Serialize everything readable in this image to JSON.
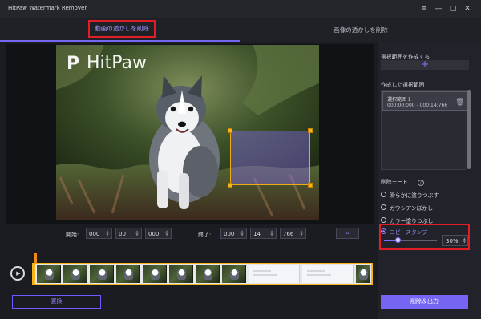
{
  "app": {
    "title": "HitPaw Watermark Remover",
    "window_controls": [
      "≡",
      "—",
      "□",
      "✕"
    ]
  },
  "tabs": {
    "video": "動画の透かしを削除",
    "image": "画像の透かしを削除"
  },
  "preview": {
    "watermark_text": "HitPaw",
    "watermark_mark": "P"
  },
  "timebar": {
    "start_label": "開始:",
    "start": [
      "000",
      "00",
      "000"
    ],
    "end_label": "終了:",
    "end": [
      "000",
      "14",
      "766"
    ],
    "snap_icon": "⌕"
  },
  "timeline": {
    "play_icon": "▶"
  },
  "buttons": {
    "reset": "置換",
    "export": "削除＆出力"
  },
  "panel": {
    "create_heading": "選択範囲を作成する",
    "add_icon": "+",
    "created_heading": "作成した選択範囲",
    "range_name": "選択範囲 1",
    "range_time": "000:00:000 - 000:14:766",
    "trash_icon": "🗑",
    "mode_heading": "削除モード",
    "help_icon": "?",
    "modes": [
      "滑らかに塗りつぶす",
      "ガウシアンぼかし",
      "カラー塗りつぶし",
      "コピースタンプ"
    ],
    "percent": "30%",
    "slider_fraction": 0.28
  },
  "colors": {
    "accent": "#7565f2",
    "highlight_border": "#e21d25",
    "selection_handle": "#f6b31a"
  }
}
